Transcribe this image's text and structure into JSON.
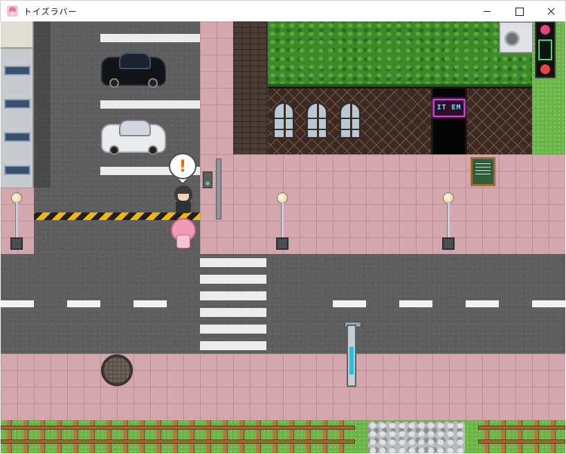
{
  "window": {
    "title": "トイズラバー",
    "icon": "app-icon",
    "buttons": {
      "minimize": "minimize-icon",
      "maximize": "maximize-icon",
      "close": "close-icon"
    }
  },
  "scene": {
    "shop_sign_text": "IT EM",
    "speech_bubble_symbol": "!"
  }
}
